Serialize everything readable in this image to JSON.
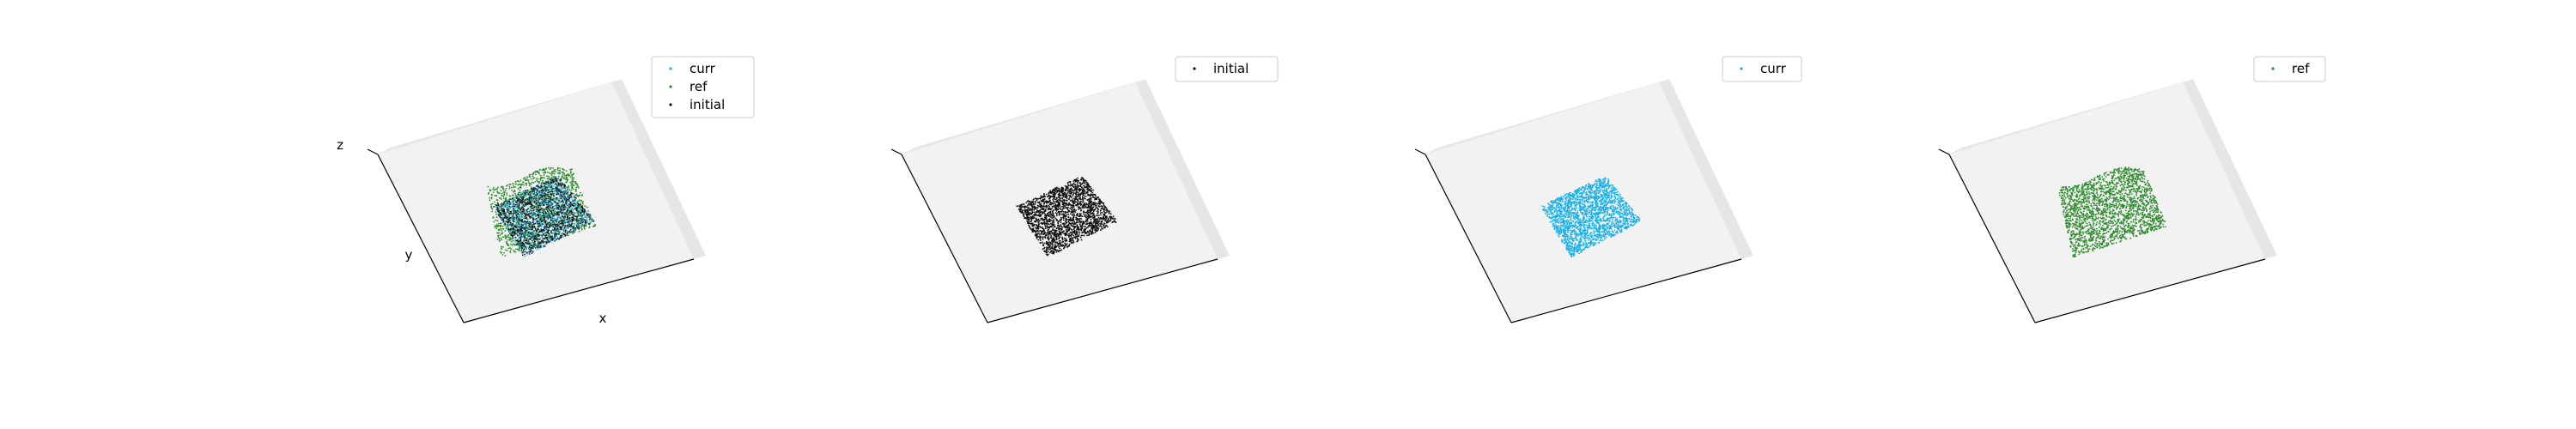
{
  "figure": {
    "background": "#ffffff",
    "pane_color": "#f2f2f2",
    "pane_edge_color": "#e6e6e6",
    "axis_color": "#000000"
  },
  "chart_data": [
    {
      "type": "scatter3d",
      "axis_labels": {
        "x": "x",
        "y": "y",
        "z": "z"
      },
      "legend": {
        "location": "top-right",
        "entries": [
          "curr",
          "ref",
          "initial"
        ]
      },
      "series": [
        {
          "name": "ref",
          "color": "#2e8b2e",
          "shape": "wavy-sheet"
        },
        {
          "name": "initial",
          "color": "#111111",
          "shape": "flat-sheet"
        },
        {
          "name": "curr",
          "color": "#1ab0e8",
          "shape": "flat-sheet",
          "alpha": 0.45
        }
      ]
    },
    {
      "type": "scatter3d",
      "axis_labels": {
        "x": "",
        "y": "",
        "z": ""
      },
      "legend": {
        "location": "top-right",
        "entries": [
          "initial"
        ]
      },
      "series": [
        {
          "name": "initial",
          "color": "#111111",
          "shape": "flat-sheet"
        }
      ]
    },
    {
      "type": "scatter3d",
      "axis_labels": {
        "x": "",
        "y": "",
        "z": ""
      },
      "legend": {
        "location": "top-right",
        "entries": [
          "curr"
        ]
      },
      "series": [
        {
          "name": "curr",
          "color": "#1ab0e8",
          "shape": "flat-sheet"
        }
      ]
    },
    {
      "type": "scatter3d",
      "axis_labels": {
        "x": "",
        "y": "",
        "z": ""
      },
      "legend": {
        "location": "top-right",
        "entries": [
          "ref"
        ]
      },
      "series": [
        {
          "name": "ref",
          "color": "#2e8b2e",
          "shape": "wavy-sheet"
        }
      ]
    }
  ]
}
